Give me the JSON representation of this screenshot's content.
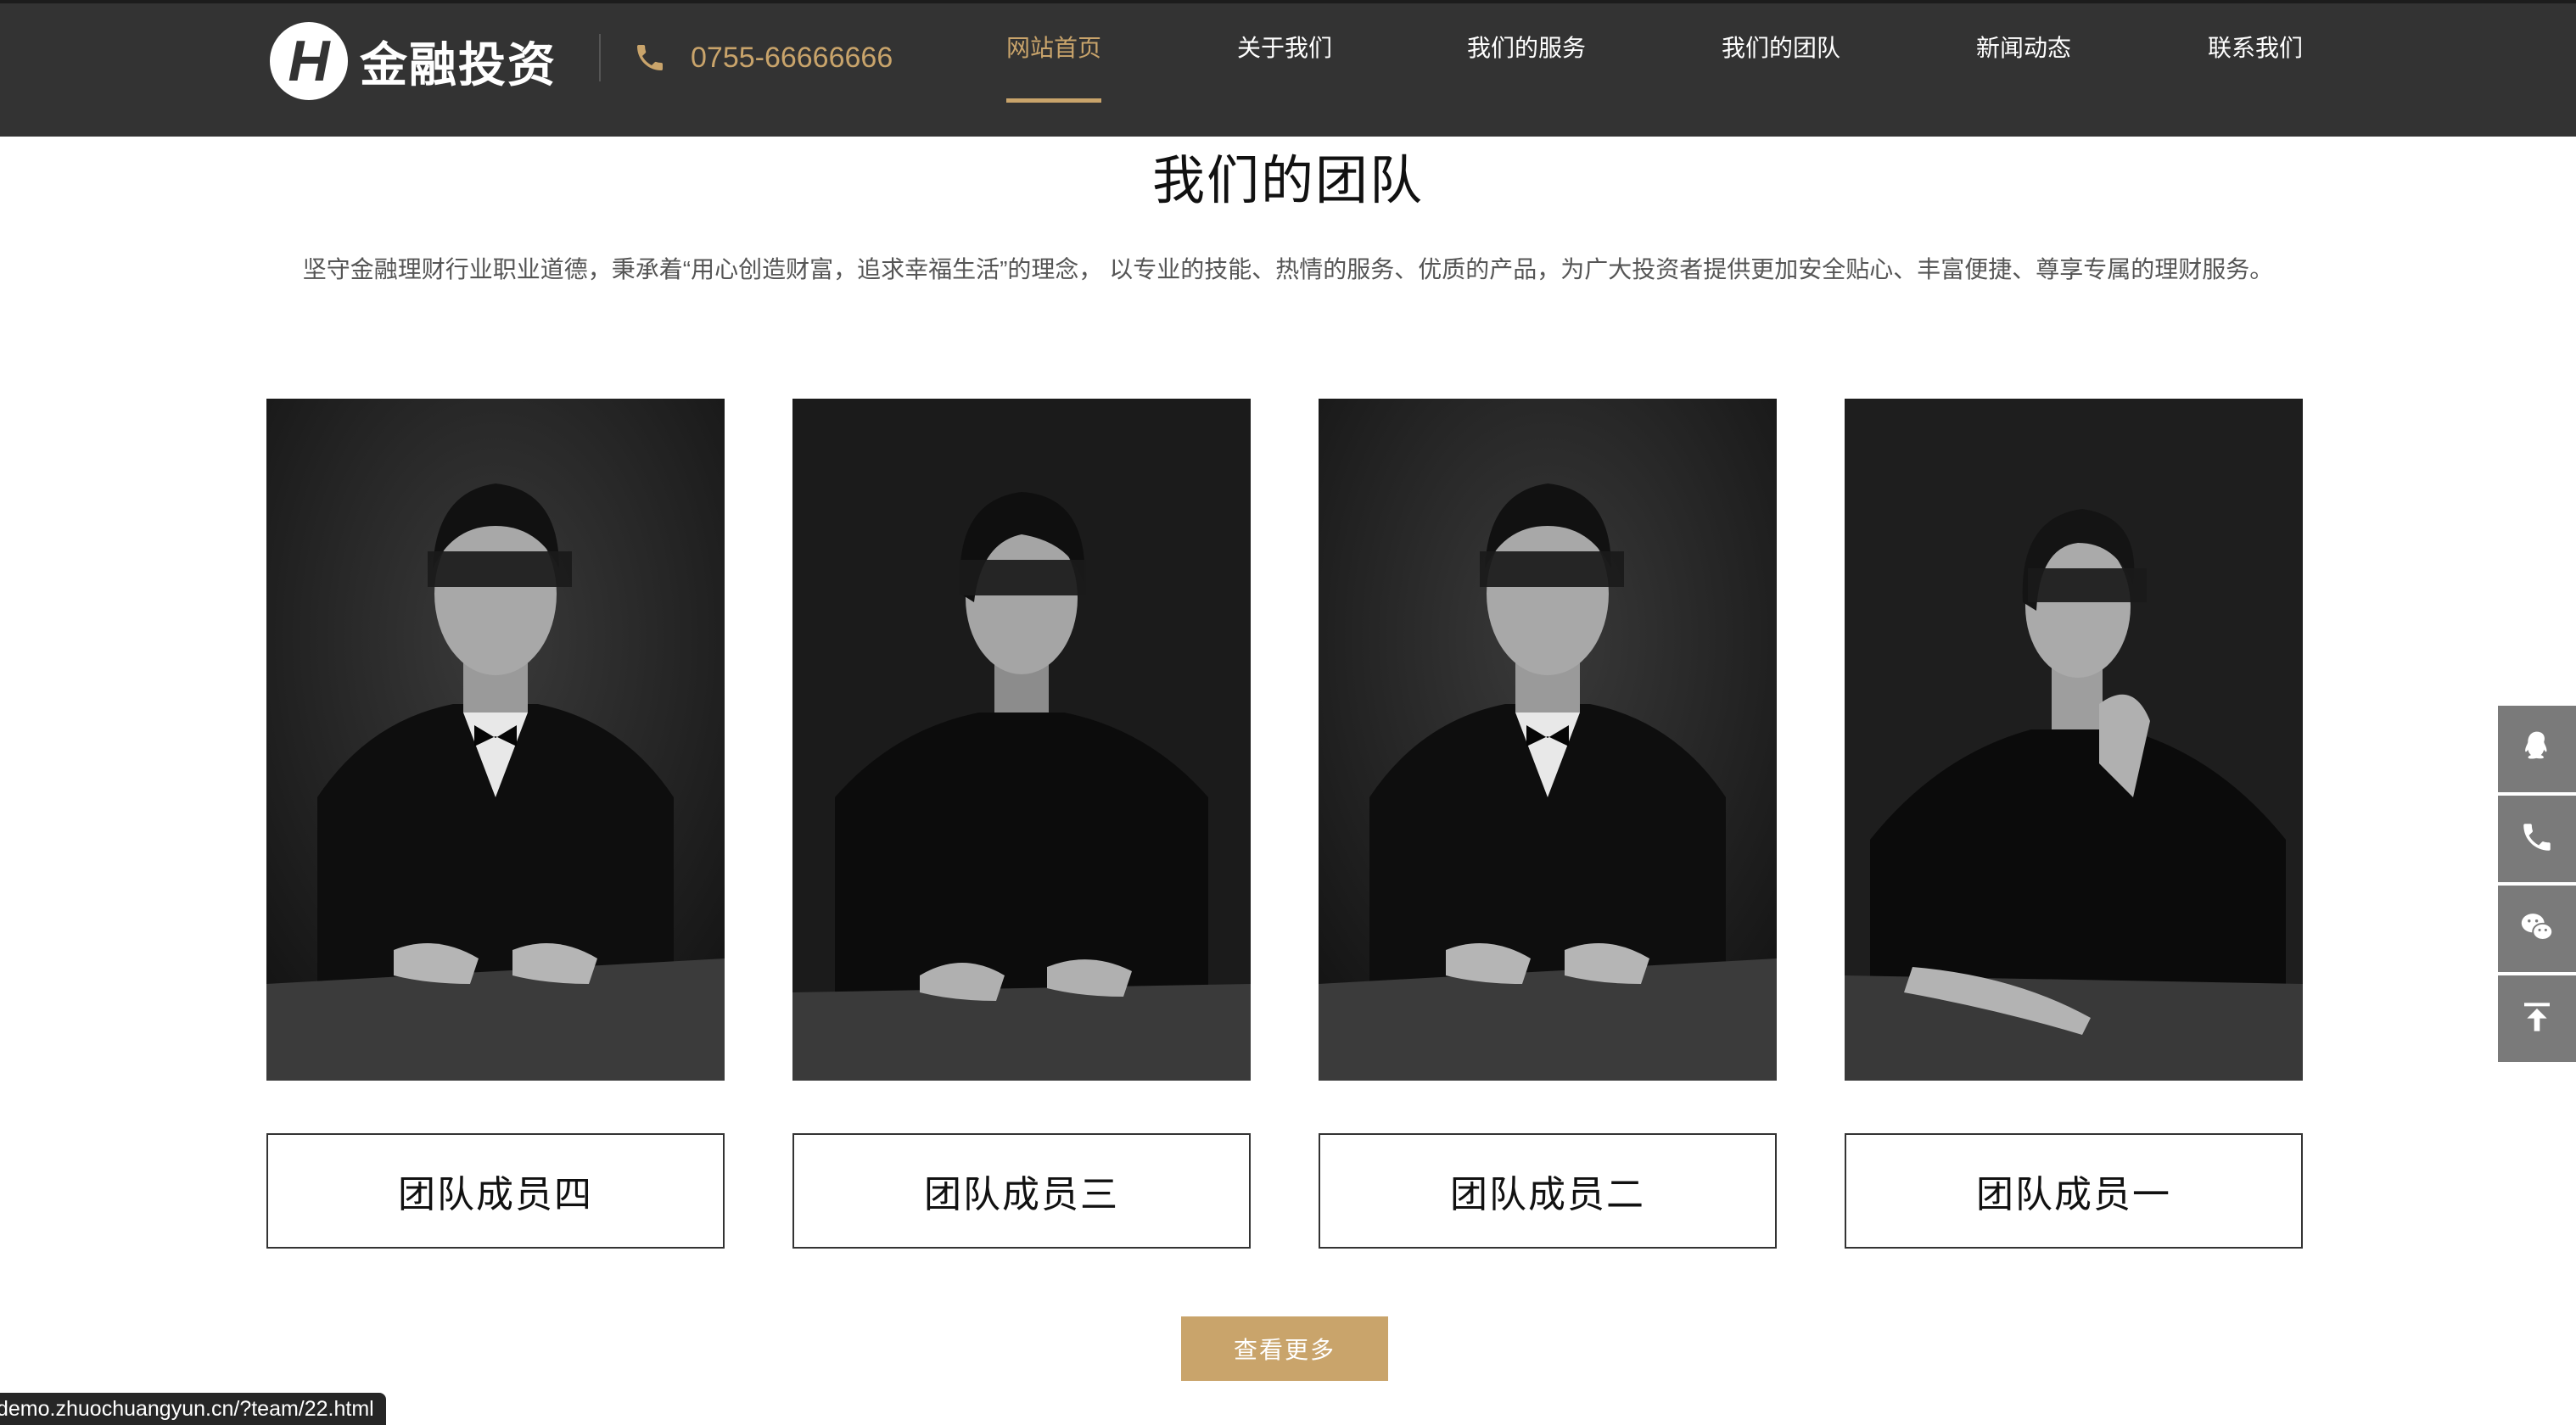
{
  "header": {
    "logo_text": "金融投资",
    "logo_letter": "H",
    "phone": "0755-66666666",
    "nav": [
      {
        "label": "网站首页",
        "active": true
      },
      {
        "label": "关于我们"
      },
      {
        "label": "我们的服务"
      },
      {
        "label": "我们的团队"
      },
      {
        "label": "新闻动态"
      },
      {
        "label": "联系我们"
      }
    ]
  },
  "section": {
    "title": "我们的团队",
    "description": "坚守金融理财行业职业道德，秉承着“用心创造财富，追求幸福生活”的理念， 以专业的技能、热情的服务、优质的产品，为广大投资者提供更加安全贴心、丰富便捷、尊享专属的理财服务。"
  },
  "members": [
    {
      "name": "团队成员四",
      "photo": "man-in-tuxedo-portrait"
    },
    {
      "name": "团队成员三",
      "photo": "woman-in-black-shirt-portrait"
    },
    {
      "name": "团队成员二",
      "photo": "man-in-tuxedo-portrait"
    },
    {
      "name": "团队成员一",
      "photo": "woman-in-black-dress-portrait"
    }
  ],
  "more_button": "查看更多",
  "float_bar": [
    "qq-icon",
    "phone-icon",
    "wechat-icon",
    "back-to-top-icon"
  ],
  "status_url": "demo.zhuochuangyun.cn/?team/22.html",
  "colors": {
    "header_bg": "#333333",
    "accent_gold": "#c9a46b",
    "float_bar_bg": "#7a7a7a"
  }
}
